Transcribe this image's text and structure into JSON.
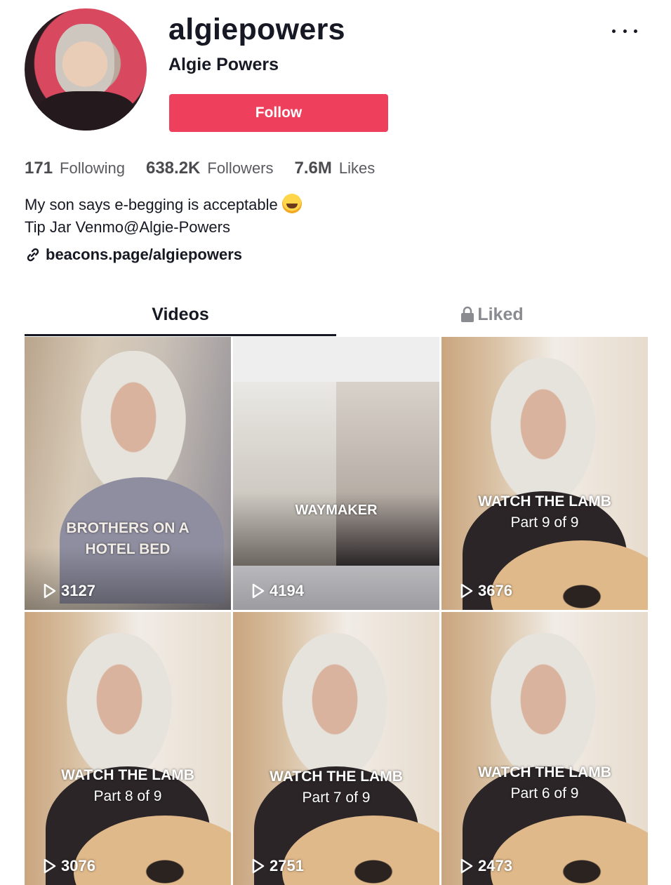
{
  "profile": {
    "username": "algiepowers",
    "nickname": "Algie Powers",
    "follow_label": "Follow",
    "stats": [
      {
        "value": "171",
        "label": "Following"
      },
      {
        "value": "638.2K",
        "label": "Followers"
      },
      {
        "value": "7.6M",
        "label": "Likes"
      }
    ],
    "bio_line1": "My son says e-begging is acceptable",
    "bio_line2": "Tip Jar Venmo@Algie-Powers",
    "link": "beacons.page/algiepowers"
  },
  "tabs": [
    {
      "label": "Videos",
      "active": true
    },
    {
      "label": "Liked",
      "active": false,
      "locked": true
    }
  ],
  "accent_color": "#ee3f5c",
  "videos": [
    {
      "caption": "BROTHERS ON A",
      "caption2": "HOTEL BED",
      "plays": "3127"
    },
    {
      "caption": "WAYMAKER",
      "caption2": "",
      "plays": "4194"
    },
    {
      "caption": "WATCH THE LAMB",
      "caption2": "Part 9 of 9",
      "plays": "3676"
    },
    {
      "caption": "WATCH THE LAMB",
      "caption2": "Part 8 of 9",
      "plays": "3076"
    },
    {
      "caption": "WATCH THE LAMB",
      "caption2": "Part 7 of 9",
      "plays": "2751"
    },
    {
      "caption": "WATCH THE LAMB",
      "caption2": "Part 6 of 9",
      "plays": "2473"
    }
  ]
}
